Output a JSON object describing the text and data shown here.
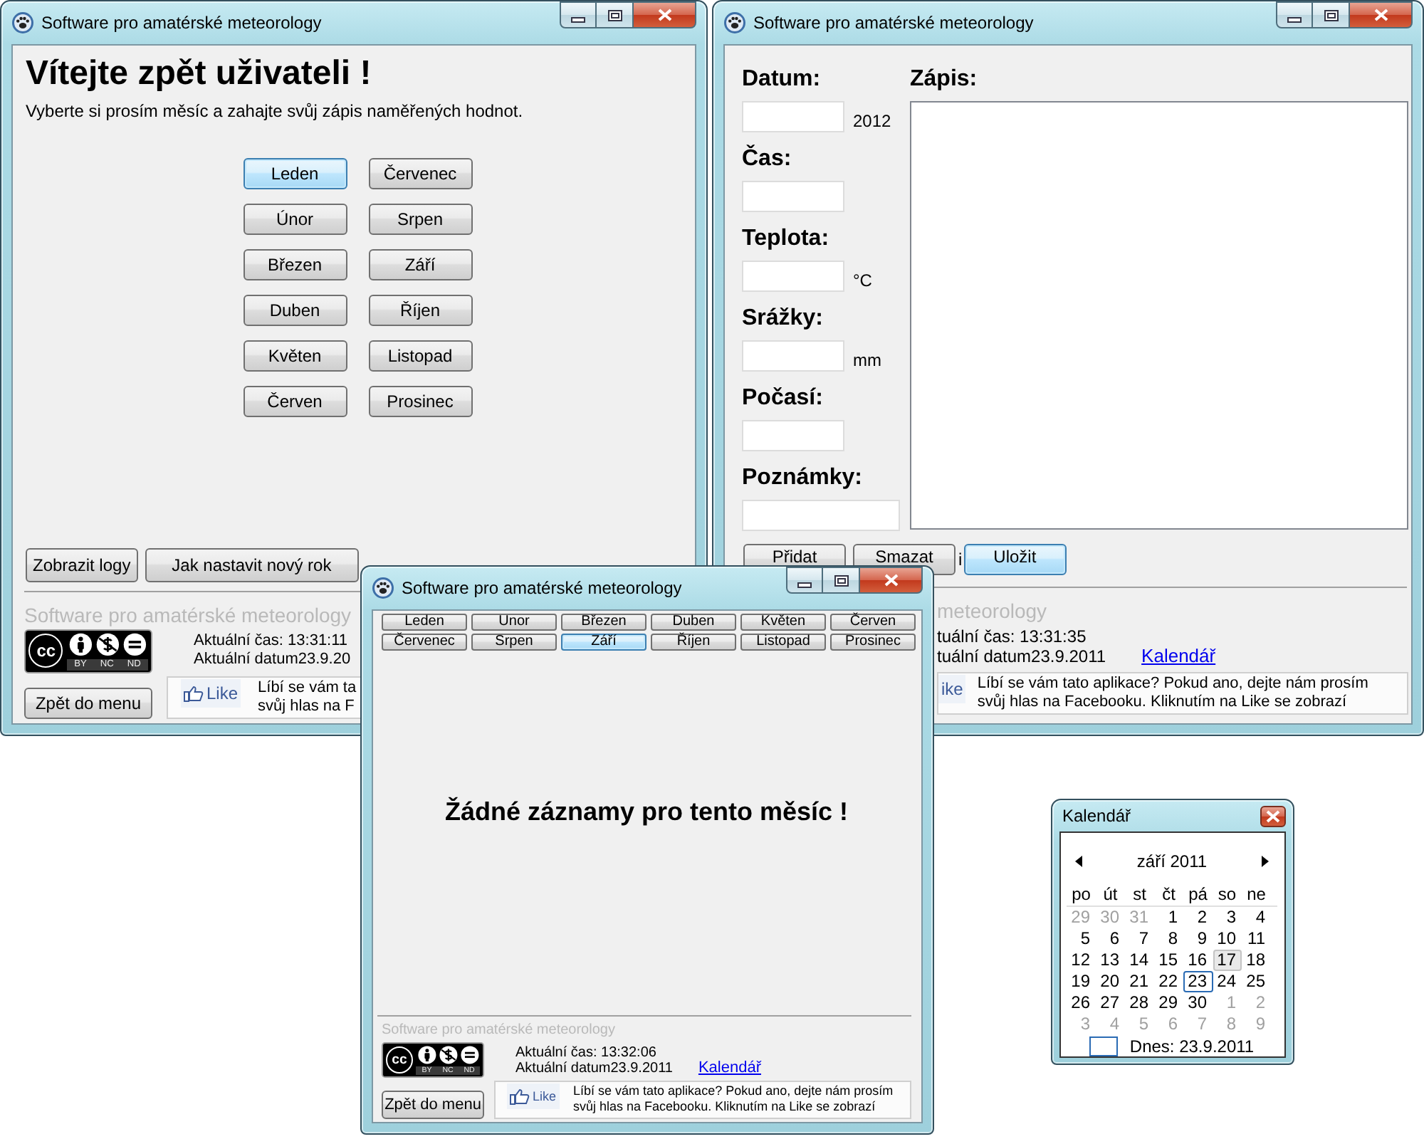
{
  "main_window": {
    "title": "Software pro amatérské meteorology",
    "heading": "Vítejte zpět uživateli !",
    "intro": "Vyberte si prosím měsíc a zahajte svůj zápis naměřených hodnot.",
    "months": [
      {
        "label": "Leden",
        "selected": true
      },
      {
        "label": "Červenec",
        "selected": false
      },
      {
        "label": "Únor",
        "selected": false
      },
      {
        "label": "Srpen",
        "selected": false
      },
      {
        "label": "Březen",
        "selected": false
      },
      {
        "label": "Září",
        "selected": false
      },
      {
        "label": "Duben",
        "selected": false
      },
      {
        "label": "Říjen",
        "selected": false
      },
      {
        "label": "Květen",
        "selected": false
      },
      {
        "label": "Listopad",
        "selected": false
      },
      {
        "label": "Červen",
        "selected": false
      },
      {
        "label": "Prosinec",
        "selected": false
      }
    ],
    "buttons": [
      "Zobrazit logy",
      "Jak nastavit nový rok"
    ],
    "footer": {
      "app_name": "Software pro amatérské meteorology",
      "license": {
        "mark": "cc",
        "terms": [
          "BY",
          "NC",
          "ND"
        ]
      },
      "time": "Aktuální čas: 13:31:11",
      "date": "Aktuální datum23.9.20",
      "back": "Zpět do menu",
      "like": "Like",
      "message": [
        "Líbí se vám ta",
        "svůj hlas na F"
      ]
    }
  },
  "entry_window": {
    "title": "Software pro amatérské meteorology",
    "fields": [
      {
        "label": "Datum:",
        "kind": "short",
        "unit": "2012"
      },
      {
        "label": "Čas:",
        "kind": "short"
      },
      {
        "label": "Teplota:",
        "kind": "short",
        "unit": "°C"
      },
      {
        "label": "Srážky:",
        "kind": "short",
        "unit": "mm"
      },
      {
        "label": "Počasí:",
        "kind": "short"
      },
      {
        "label": "Poznámky:",
        "kind": "wide"
      }
    ],
    "notes_label": "Zápis:",
    "actions": [
      {
        "kind": "button",
        "label": "Přidat",
        "selected": false
      },
      {
        "kind": "button",
        "label": "Smazat",
        "selected": false
      },
      {
        "kind": "text",
        "label": "i"
      },
      {
        "kind": "button",
        "label": "Uložit",
        "selected": true
      }
    ],
    "footer": {
      "app_name": "meteorology",
      "time": "tuální čas: 13:31:35",
      "date": "tuální datum23.9.2011",
      "link": "Kalendář",
      "like": "ike",
      "message": [
        "Líbí se vám tato aplikace? Pokud ano, dejte nám prosím",
        "svůj hlas na Facebooku. Kliknutím na Like se zobrazí"
      ]
    }
  },
  "records_window": {
    "title": "Software pro amatérské meteorology",
    "months": [
      {
        "label": "Leden",
        "selected": false
      },
      {
        "label": "Unor",
        "selected": false
      },
      {
        "label": "Březen",
        "selected": false
      },
      {
        "label": "Duben",
        "selected": false
      },
      {
        "label": "Květen",
        "selected": false
      },
      {
        "label": "Červen",
        "selected": false
      },
      {
        "label": "Červenec",
        "selected": false
      },
      {
        "label": "Srpen",
        "selected": false
      },
      {
        "label": "Září",
        "selected": true
      },
      {
        "label": "Říjen",
        "selected": false
      },
      {
        "label": "Listopad",
        "selected": false
      },
      {
        "label": "Prosinec",
        "selected": false
      }
    ],
    "message": "Žádné záznamy pro tento měsíc !",
    "footer": {
      "app_name": "Software pro amatérské meteorology",
      "license": {
        "mark": "cc",
        "terms": [
          "BY",
          "NC",
          "ND"
        ]
      },
      "time": "Aktuální čas: 13:32:06",
      "date": "Aktuální datum23.9.2011",
      "link": "Kalendář",
      "back": "Zpět do menu",
      "like": "Like",
      "message": [
        "Líbí se vám tato aplikace? Pokud ano, dejte nám prosím",
        "svůj hlas na Facebooku. Kliknutím na Like se zobrazí"
      ]
    }
  },
  "calendar_window": {
    "title": "Kalendář",
    "month": "září 2011",
    "weekdays": [
      "po",
      "út",
      "st",
      "čt",
      "pá",
      "so",
      "ne"
    ],
    "weeks": [
      [
        {
          "d": "29",
          "kind": "outside"
        },
        {
          "d": "30",
          "kind": "outside"
        },
        {
          "d": "31",
          "kind": "outside"
        },
        {
          "d": "1",
          "kind": "normal"
        },
        {
          "d": "2",
          "kind": "normal"
        },
        {
          "d": "3",
          "kind": "normal"
        },
        {
          "d": "4",
          "kind": "normal"
        }
      ],
      [
        {
          "d": "5",
          "kind": "normal"
        },
        {
          "d": "6",
          "kind": "normal"
        },
        {
          "d": "7",
          "kind": "normal"
        },
        {
          "d": "8",
          "kind": "normal"
        },
        {
          "d": "9",
          "kind": "normal"
        },
        {
          "d": "10",
          "kind": "normal"
        },
        {
          "d": "11",
          "kind": "normal"
        }
      ],
      [
        {
          "d": "12",
          "kind": "normal"
        },
        {
          "d": "13",
          "kind": "normal"
        },
        {
          "d": "14",
          "kind": "normal"
        },
        {
          "d": "15",
          "kind": "normal"
        },
        {
          "d": "16",
          "kind": "normal"
        },
        {
          "d": "17",
          "kind": "hover"
        },
        {
          "d": "18",
          "kind": "normal"
        }
      ],
      [
        {
          "d": "19",
          "kind": "normal"
        },
        {
          "d": "20",
          "kind": "normal"
        },
        {
          "d": "21",
          "kind": "normal"
        },
        {
          "d": "22",
          "kind": "normal"
        },
        {
          "d": "23",
          "kind": "today"
        },
        {
          "d": "24",
          "kind": "normal"
        },
        {
          "d": "25",
          "kind": "normal"
        }
      ],
      [
        {
          "d": "26",
          "kind": "normal"
        },
        {
          "d": "27",
          "kind": "normal"
        },
        {
          "d": "28",
          "kind": "normal"
        },
        {
          "d": "29",
          "kind": "normal"
        },
        {
          "d": "30",
          "kind": "normal"
        },
        {
          "d": "1",
          "kind": "outside"
        },
        {
          "d": "2",
          "kind": "outside"
        }
      ],
      [
        {
          "d": "3",
          "kind": "outside"
        },
        {
          "d": "4",
          "kind": "outside"
        },
        {
          "d": "5",
          "kind": "outside"
        },
        {
          "d": "6",
          "kind": "outside"
        },
        {
          "d": "7",
          "kind": "outside"
        },
        {
          "d": "8",
          "kind": "outside"
        },
        {
          "d": "9",
          "kind": "outside"
        }
      ]
    ],
    "today": "Dnes: 23.9.2011"
  }
}
